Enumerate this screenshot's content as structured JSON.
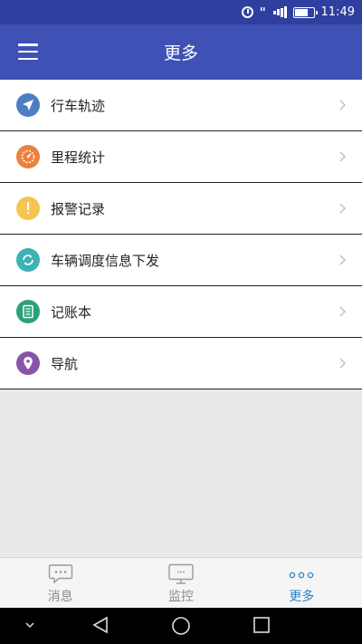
{
  "status_bar": {
    "time": "11:49",
    "battery_level": 0.75
  },
  "app_bar": {
    "title": "更多"
  },
  "menu": {
    "items": [
      {
        "label": "行车轨迹",
        "icon": "navigation-arrow-icon",
        "color": "#4f7dc2"
      },
      {
        "label": "里程统计",
        "icon": "speedometer-icon",
        "color": "#ee8040"
      },
      {
        "label": "报警记录",
        "icon": "exclamation-icon",
        "color": "#f5c550"
      },
      {
        "label": "车辆调度信息下发",
        "icon": "refresh-circle-icon",
        "color": "#3ab2b6"
      },
      {
        "label": "记账本",
        "icon": "notebook-icon",
        "color": "#2aa17a"
      },
      {
        "label": "导航",
        "icon": "location-pin-icon",
        "color": "#8a55a6"
      }
    ]
  },
  "bottom_nav": {
    "tabs": [
      {
        "label": "消息",
        "icon": "message-bubble-icon",
        "active": false
      },
      {
        "label": "监控",
        "icon": "monitor-icon",
        "active": false
      },
      {
        "label": "更多",
        "icon": "more-dots-icon",
        "active": true
      }
    ],
    "active_color": "#2a82c6",
    "inactive_color": "#8a8a8a"
  }
}
